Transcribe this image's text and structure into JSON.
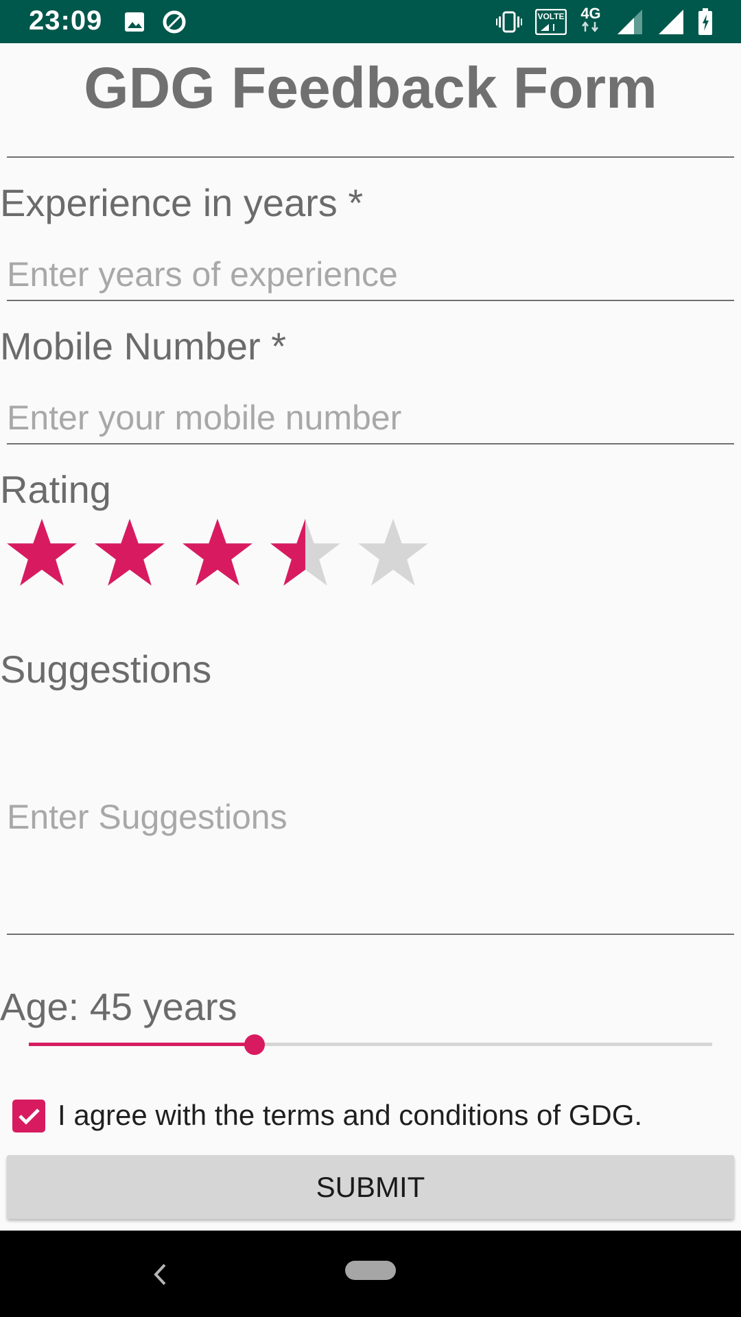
{
  "status_bar": {
    "time": "23:09",
    "icons": [
      "image-icon",
      "data-saver-icon",
      "vibrate-icon",
      "volte-icon",
      "network-4g-icon",
      "signal-icon",
      "signal-icon",
      "battery-icon"
    ],
    "volte_label": "VOLTE",
    "network_label": "4G"
  },
  "form": {
    "title": "GDG Feedback Form",
    "experience": {
      "label": "Experience in years *",
      "placeholder": "Enter years of experience"
    },
    "mobile": {
      "label": "Mobile Number *",
      "placeholder": "Enter your mobile number"
    },
    "rating": {
      "label": "Rating",
      "value": 3.5,
      "max": 5
    },
    "suggestions": {
      "label": "Suggestions",
      "placeholder": "Enter Suggestions"
    },
    "age": {
      "label": "Age: 45 years",
      "value": 45,
      "slider_fraction": 0.33
    },
    "terms": {
      "checked": true,
      "label": "I agree with the terms and conditions of GDG."
    },
    "submit_label": "SUBMIT"
  },
  "colors": {
    "accent": "#d81b60",
    "status_bar": "#00574b",
    "star_empty": "#d6d6d6",
    "text": "#6b6b6b"
  },
  "nav_bar": {
    "icons": [
      "back-icon",
      "home-pill-icon"
    ]
  }
}
